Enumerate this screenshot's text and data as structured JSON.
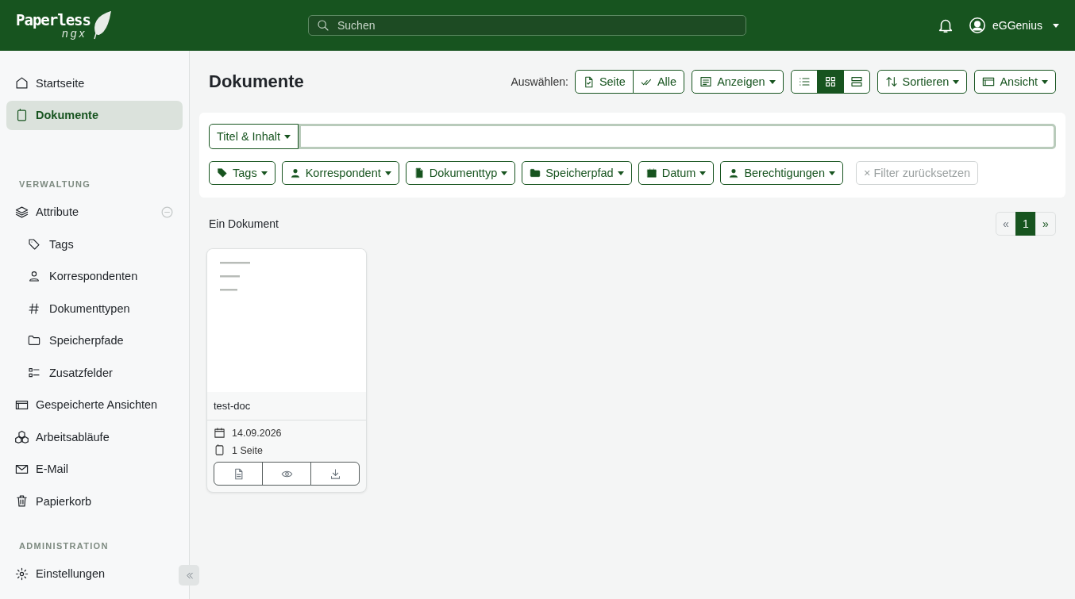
{
  "header": {
    "logo": {
      "title": "Paperless",
      "subtitle": "ngx"
    },
    "search": {
      "placeholder": "Suchen"
    },
    "user": "eGGenius"
  },
  "sidebar": {
    "items": [
      {
        "label": "Startseite",
        "selected": false
      },
      {
        "label": "Dokumente",
        "selected": true
      }
    ],
    "sections": [
      {
        "heading": "VERWALTUNG",
        "items": [
          {
            "label": "Attribute",
            "expanded": true,
            "children": [
              {
                "label": "Tags"
              },
              {
                "label": "Korrespondenten"
              },
              {
                "label": "Dokumenttypen"
              },
              {
                "label": "Speicherpfade"
              },
              {
                "label": "Zusatzfelder"
              }
            ]
          },
          {
            "label": "Gespeicherte Ansichten"
          },
          {
            "label": "Arbeitsabläufe"
          },
          {
            "label": "E-Mail"
          },
          {
            "label": "Papierkorb"
          }
        ]
      },
      {
        "heading": "ADMINISTRATION",
        "items": [
          {
            "label": "Einstellungen"
          }
        ]
      }
    ]
  },
  "page": {
    "title": "Dokumente",
    "select_label": "Auswählen:",
    "select_buttons": [
      "Seite",
      "Alle"
    ],
    "display_button": "Anzeigen",
    "view_modes": [
      {
        "selected": false
      },
      {
        "selected": true
      },
      {
        "selected": false
      }
    ],
    "sort_button": "Sortieren",
    "view_button": "Ansicht"
  },
  "filter": {
    "mode": "Titel & Inhalt",
    "filters": [
      "Tags",
      "Korrespondent",
      "Dokumenttyp",
      "Speicherpfad",
      "Datum",
      "Berechtigungen"
    ],
    "reset": {
      "label": "× Filter zurücksetzen",
      "disabled": true
    }
  },
  "results": {
    "count": "Ein Dokument",
    "pages": [
      {
        "label": "«",
        "disabled": true,
        "selected": false
      },
      {
        "label": "1",
        "disabled": false,
        "selected": true
      },
      {
        "label": "»",
        "disabled": false,
        "selected": false
      }
    ]
  },
  "documents": [
    {
      "title": "test-doc",
      "date": "14.09.2026",
      "pages": "1 Seite"
    }
  ]
}
